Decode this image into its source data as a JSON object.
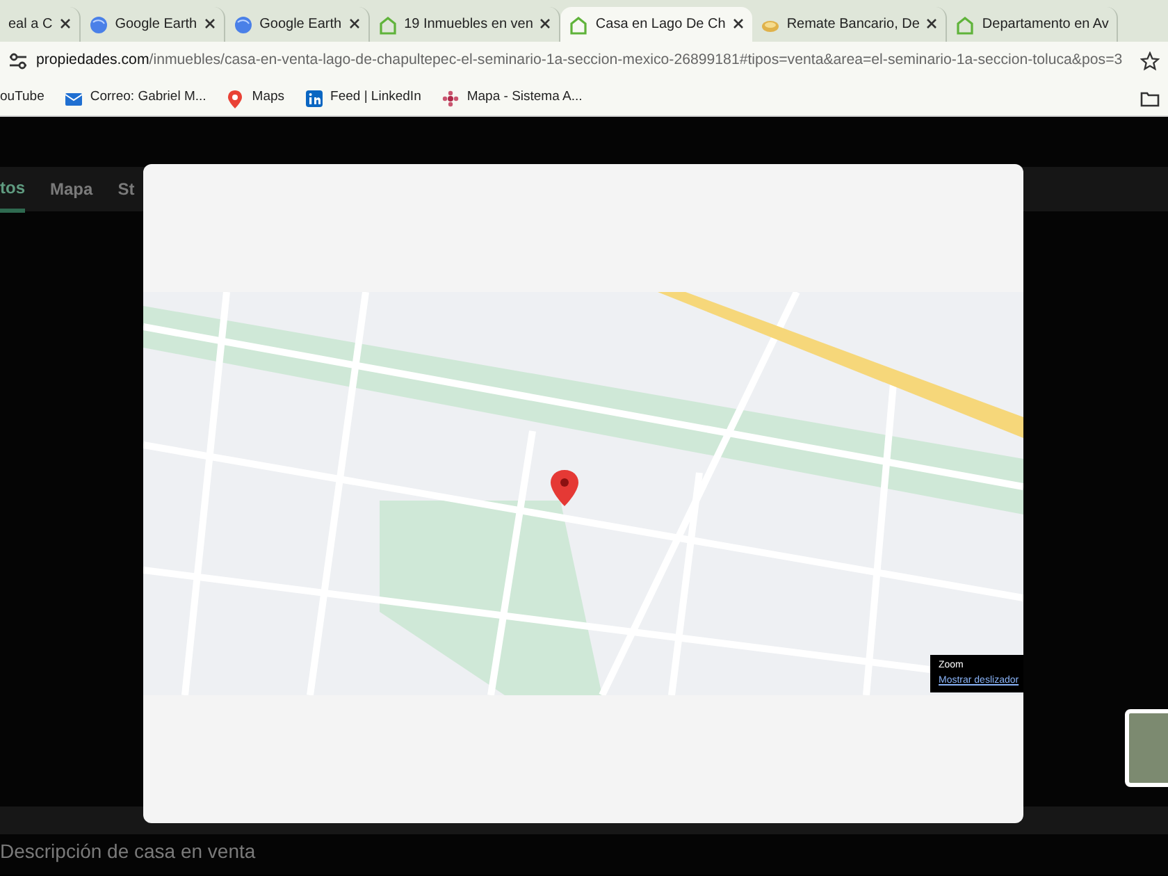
{
  "browser": {
    "tabs": [
      {
        "title": "eal a C",
        "kind": "none",
        "selected": false,
        "close": true
      },
      {
        "title": "Google Earth",
        "kind": "earth",
        "selected": false,
        "close": true
      },
      {
        "title": "Google Earth",
        "kind": "earth",
        "selected": false,
        "close": true
      },
      {
        "title": "19 Inmuebles en ven",
        "kind": "house",
        "selected": false,
        "close": true
      },
      {
        "title": "Casa en Lago De Ch",
        "kind": "house",
        "selected": true,
        "close": true
      },
      {
        "title": "Remate Bancario, De",
        "kind": "coin",
        "selected": false,
        "close": true
      },
      {
        "title": "Departamento en Av",
        "kind": "house",
        "selected": false,
        "close": false
      }
    ],
    "address": {
      "host": "propiedades.com",
      "path": "/inmuebles/casa-en-venta-lago-de-chapultepec-el-seminario-1a-seccion-mexico-26899181#tipos=venta&area=el-seminario-1a-seccion-toluca&pos=3"
    },
    "bookmarks": [
      {
        "label": "ouTube",
        "kind": "none"
      },
      {
        "label": "Correo: Gabriel M...",
        "kind": "mail"
      },
      {
        "label": "Maps",
        "kind": "pin"
      },
      {
        "label": "Feed | LinkedIn",
        "kind": "linkedin"
      },
      {
        "label": "Mapa - Sistema A...",
        "kind": "flower"
      }
    ]
  },
  "page": {
    "tabs": [
      {
        "label": "tos",
        "selected": true
      },
      {
        "label": "Mapa",
        "selected": false
      },
      {
        "label": "St",
        "selected": false
      }
    ],
    "section_title": "Descripción de casa en venta"
  },
  "modal": {
    "tooltip": {
      "title": "Zoom",
      "link": "Mostrar deslizador"
    }
  }
}
